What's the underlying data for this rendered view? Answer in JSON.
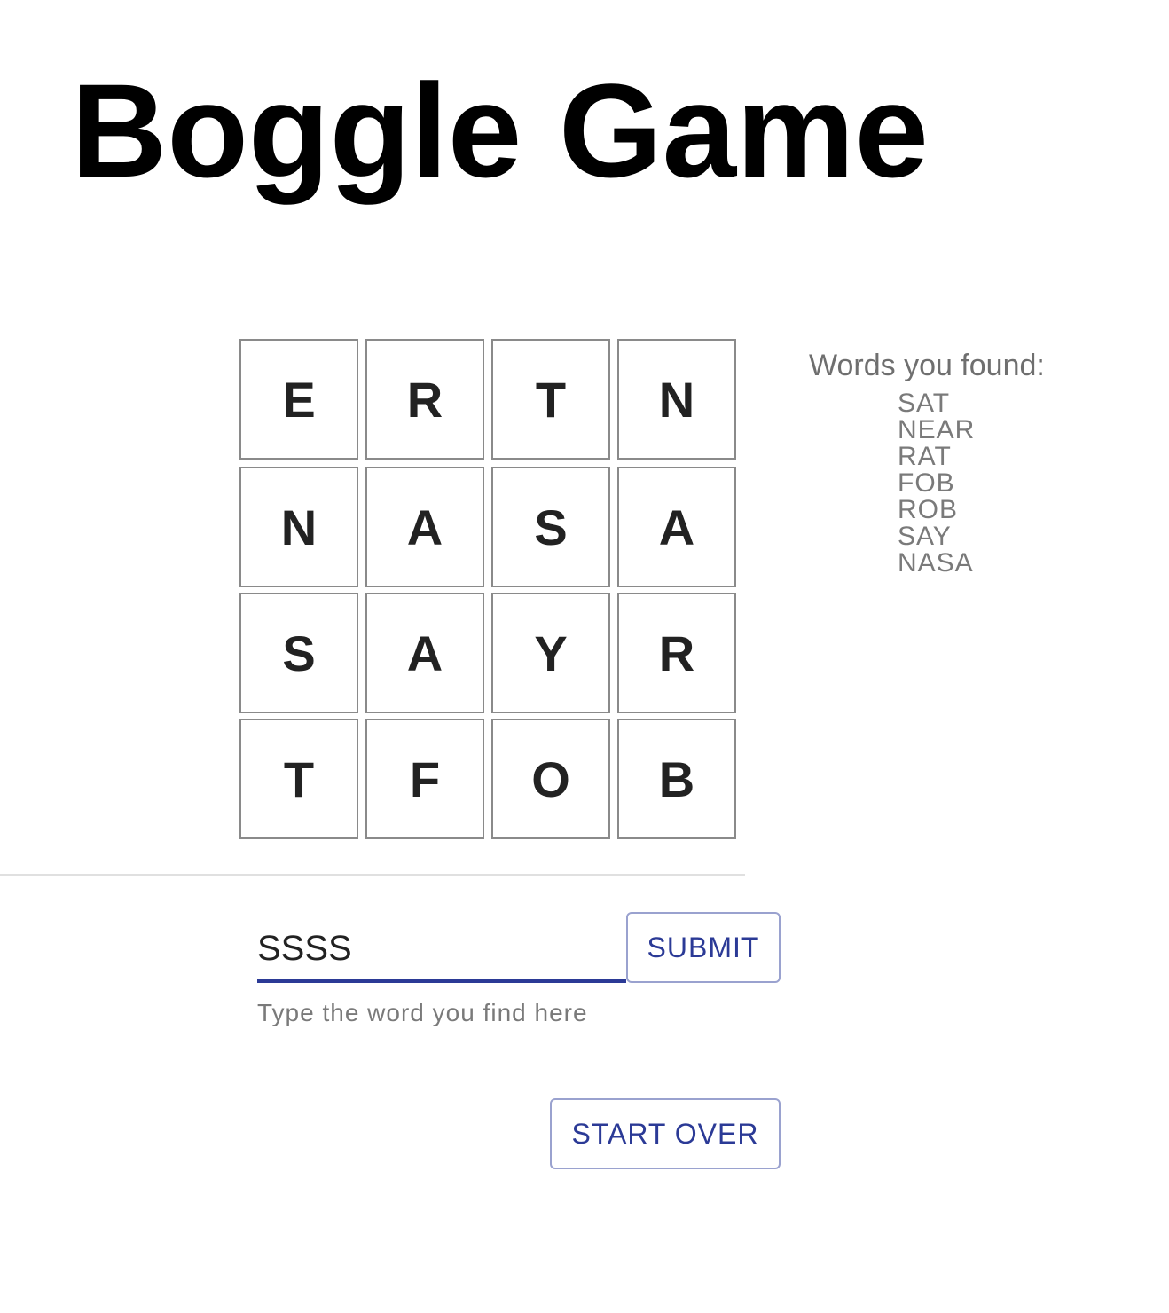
{
  "header": {
    "title": "Boggle Game"
  },
  "board": {
    "rows": [
      [
        "E",
        "R",
        "T",
        "N"
      ],
      [
        "N",
        "A",
        "S",
        "A"
      ],
      [
        "S",
        "A",
        "Y",
        "R"
      ],
      [
        "T",
        "F",
        "O",
        "B"
      ]
    ]
  },
  "found": {
    "title": "Words you found:",
    "words": [
      "SAT",
      "NEAR",
      "RAT",
      "FOB",
      "ROB",
      "SAY",
      "NASA"
    ]
  },
  "entry": {
    "value": "SSSS",
    "helper": "Type the word you find here",
    "submit_label": "SUBMIT"
  },
  "controls": {
    "start_over_label": "START OVER"
  },
  "colors": {
    "accent": "#2b3a96",
    "cell_border": "#8a8a8a",
    "muted_text": "#7a7a7a"
  }
}
